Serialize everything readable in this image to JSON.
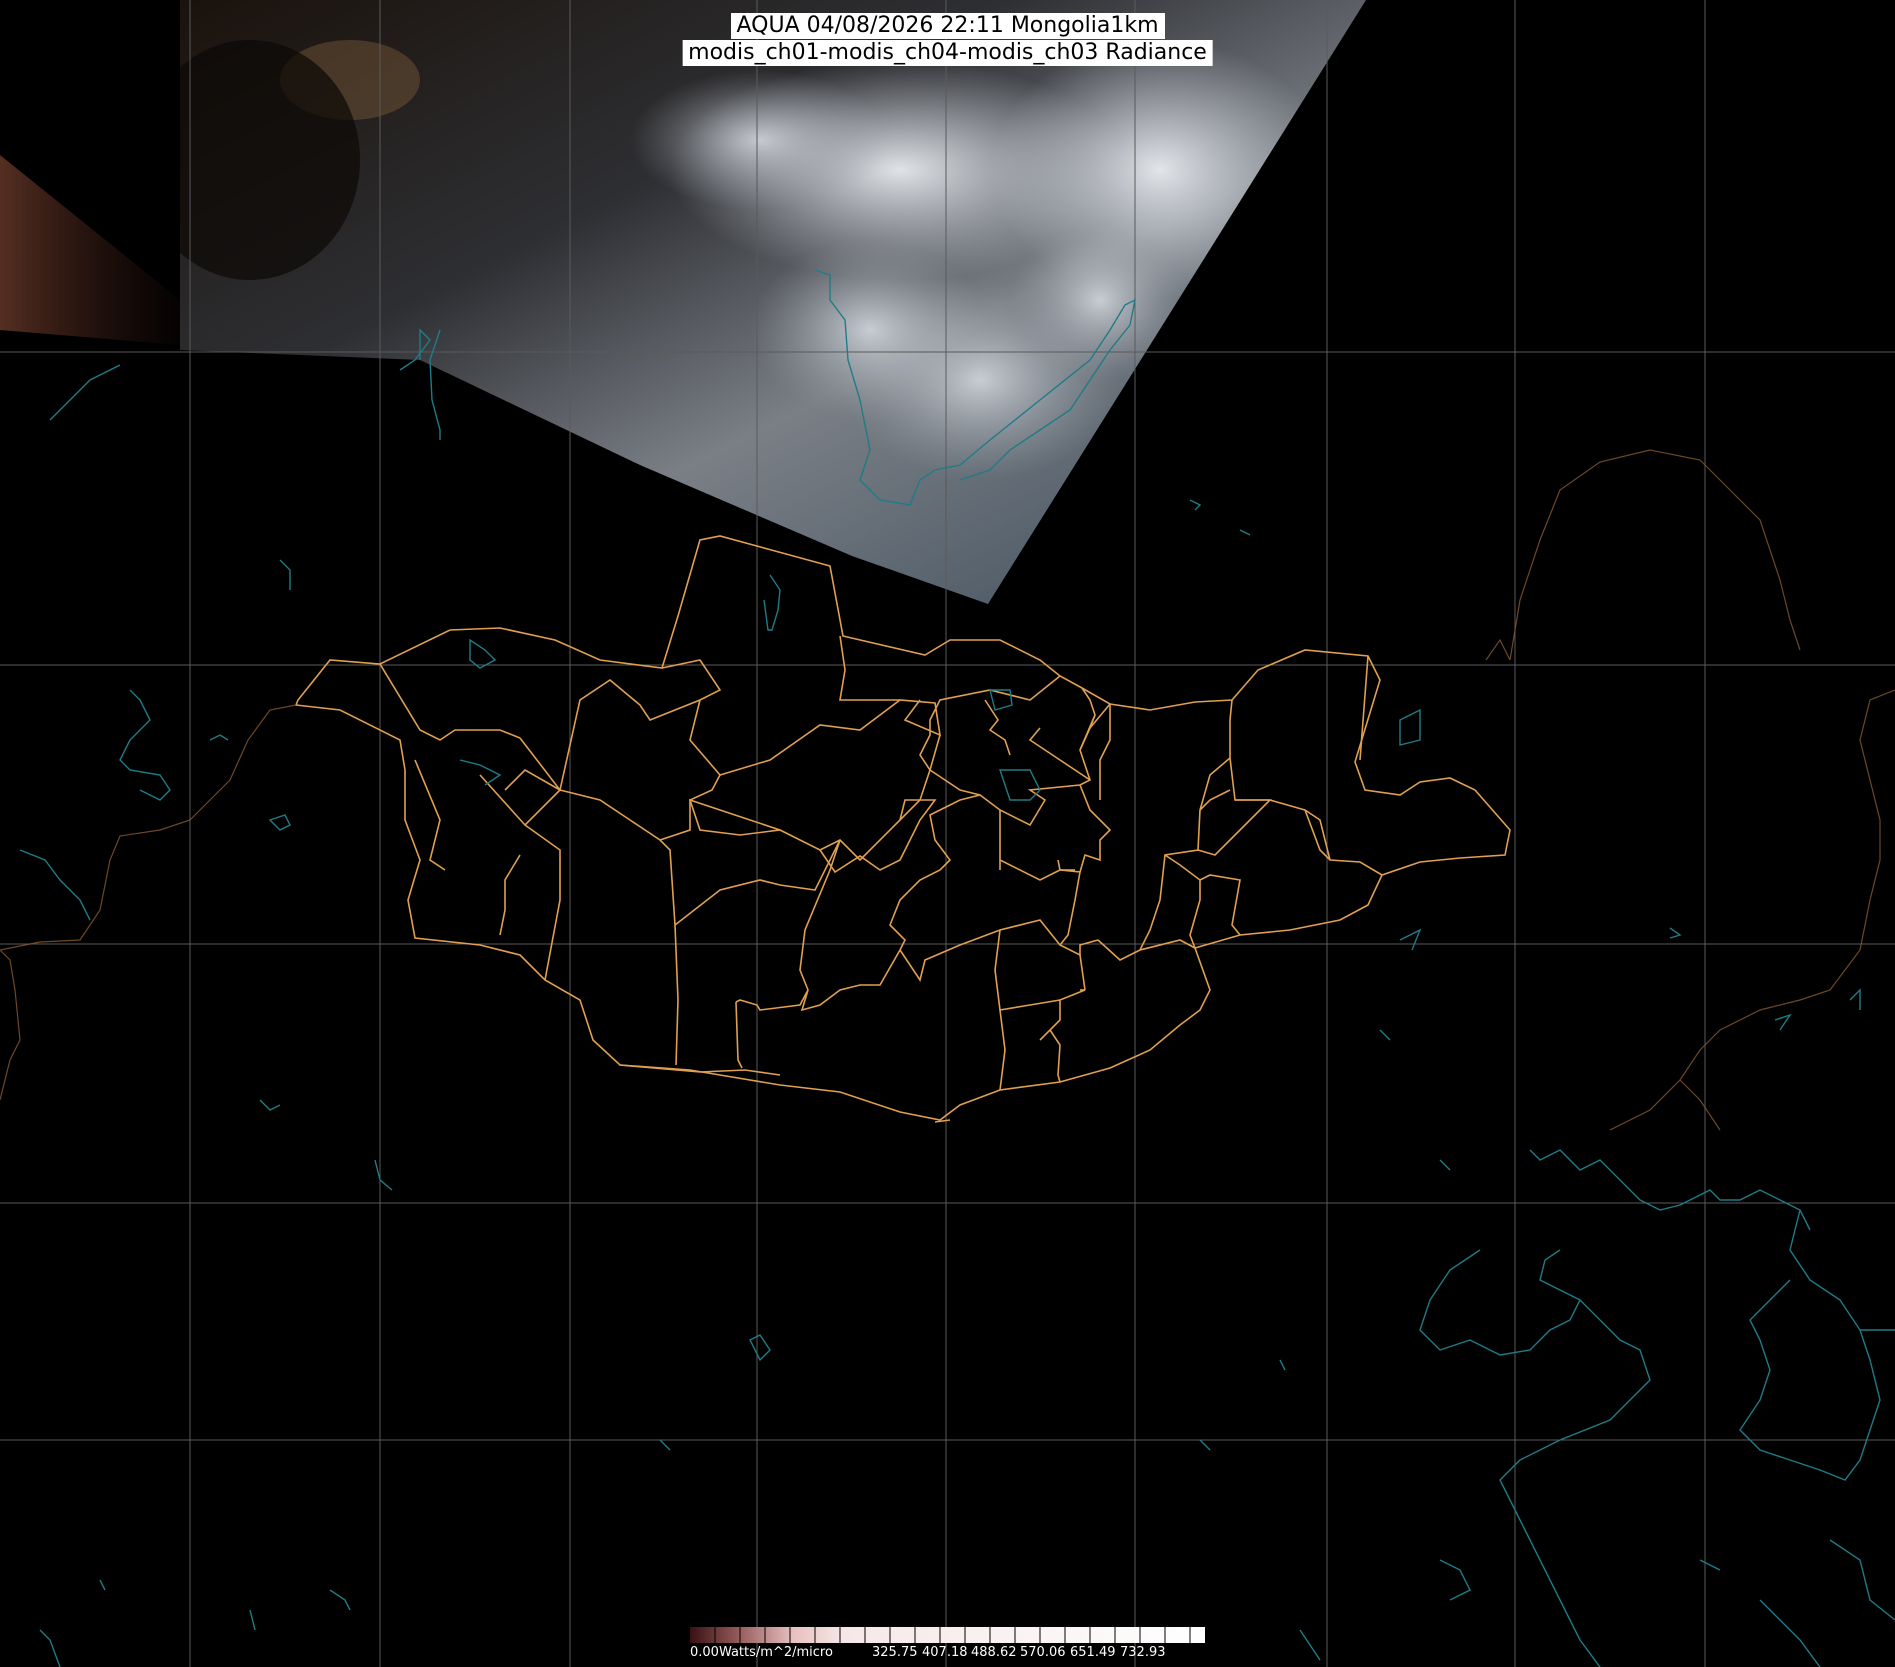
{
  "title": {
    "line1": "AQUA 04/08/2026 22:11 Mongolia1km",
    "line2": "modis_ch01-modis_ch04-modis_ch03 Radiance"
  },
  "colorbar": {
    "unit_label": "0.00Watts/m^2/micro",
    "tick_labels": [
      "325.75",
      "407.18",
      "488.62",
      "570.06",
      "651.49",
      "732.93"
    ]
  },
  "colors": {
    "background": "#000000",
    "graticule": "#5a5a5a",
    "admin_boundaries": "#e0a050",
    "coastlines_lakes": "#1f7c86",
    "title_bg": "#ffffff"
  },
  "imagery": {
    "description_type": "satellite true-color swath",
    "legend": "radiance color ramp"
  }
}
